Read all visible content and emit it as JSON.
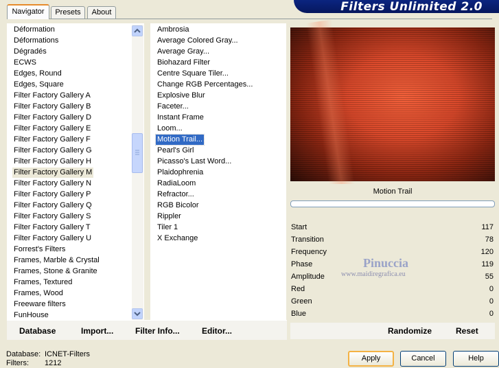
{
  "window": {
    "title": "Filters Unlimited 2.0"
  },
  "tabs": [
    {
      "label": "Navigator",
      "active": true
    },
    {
      "label": "Presets",
      "active": false
    },
    {
      "label": "About",
      "active": false
    }
  ],
  "categories": [
    "Déformation",
    "Déformations",
    "Dégradés",
    "ECWS",
    "Edges, Round",
    "Edges, Square",
    "Filter Factory Gallery A",
    "Filter Factory Gallery B",
    "Filter Factory Gallery D",
    "Filter Factory Gallery E",
    "Filter Factory Gallery F",
    "Filter Factory Gallery G",
    "Filter Factory Gallery H",
    "Filter Factory Gallery M",
    "Filter Factory Gallery N",
    "Filter Factory Gallery P",
    "Filter Factory Gallery Q",
    "Filter Factory Gallery S",
    "Filter Factory Gallery T",
    "Filter Factory Gallery U",
    "Forrest's Filters",
    "Frames, Marble & Crystal",
    "Frames, Stone & Granite",
    "Frames, Textured",
    "Frames, Wood",
    "Freeware filters",
    "FunHouse"
  ],
  "selected_category": "Filter Factory Gallery M",
  "filters": [
    "Ambrosia",
    "Average Colored Gray...",
    "Average Gray...",
    "Biohazard Filter",
    "Centre Square Tiler...",
    "Change RGB Percentages...",
    "Explosive Blur",
    "Faceter...",
    "Instant Frame",
    "Loom...",
    "Motion Trail...",
    "Pearl's Girl",
    "Picasso's Last Word...",
    "Plaidophrenia",
    "RadiaLoom",
    "Refractor...",
    "RGB Bicolor",
    "Rippler",
    "Tiler 1",
    "X Exchange"
  ],
  "selected_filter": "Motion Trail...",
  "filter_name": "Motion Trail",
  "parameters": [
    {
      "label": "Start",
      "value": "117"
    },
    {
      "label": "Transition",
      "value": "78"
    },
    {
      "label": "Frequency",
      "value": "120"
    },
    {
      "label": "Phase",
      "value": "119"
    },
    {
      "label": "Amplitude",
      "value": "55"
    },
    {
      "label": "Red",
      "value": "0"
    },
    {
      "label": "Green",
      "value": "0"
    },
    {
      "label": "Blue",
      "value": "0"
    }
  ],
  "watermark": {
    "line1": "Pinuccia",
    "line2": "www.maidiregrafica.eu"
  },
  "toolbar": {
    "database": "Database",
    "import": "Import...",
    "filter_info": "Filter Info...",
    "editor": "Editor...",
    "randomize": "Randomize",
    "reset": "Reset"
  },
  "status": {
    "database_label": "Database:",
    "database_value": "ICNET-Filters",
    "filters_label": "Filters:",
    "filters_value": "1212"
  },
  "buttons": {
    "apply": "Apply",
    "cancel": "Cancel",
    "help": "Help"
  },
  "colors": {
    "selection": "#316ac5",
    "title_bar": "#0b2580",
    "preview_accent": "#e8553a"
  }
}
